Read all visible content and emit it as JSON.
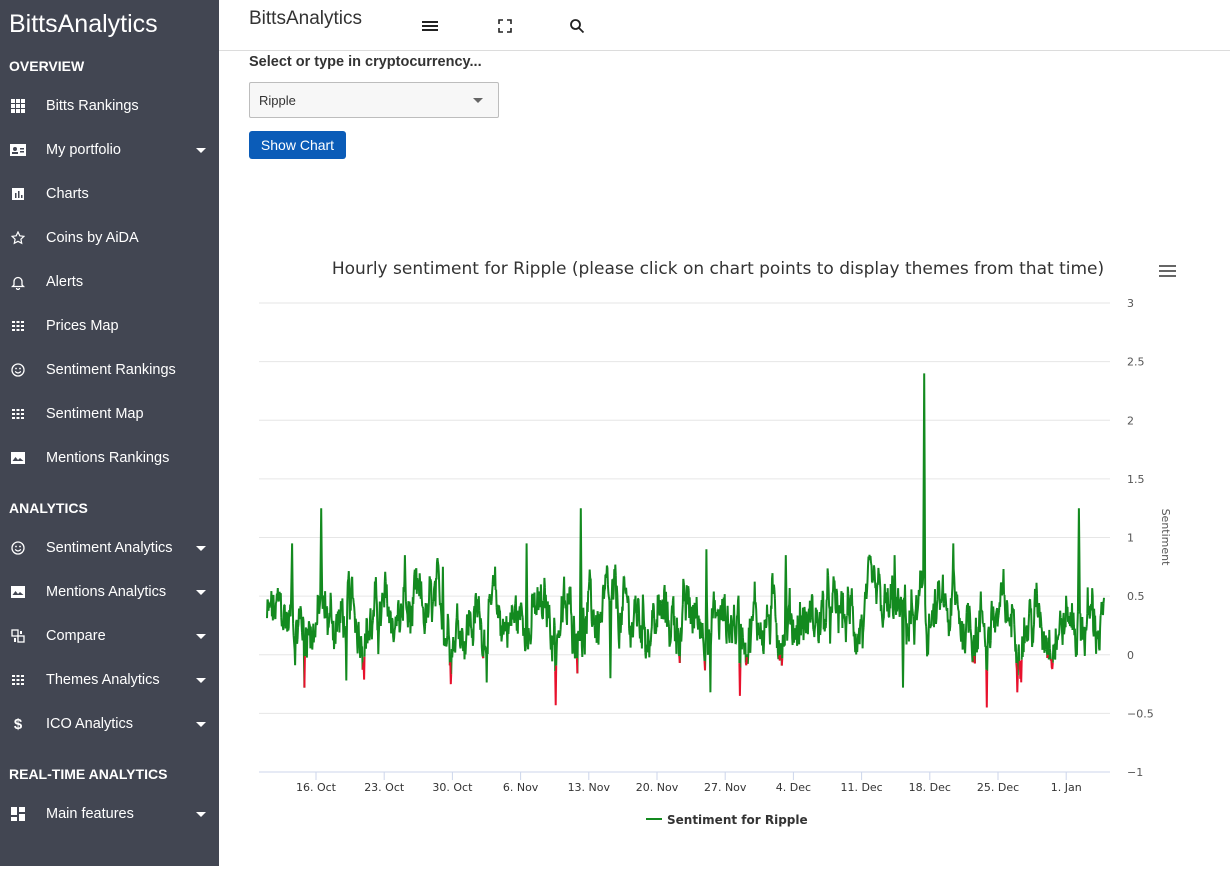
{
  "sidebar": {
    "brand": "BittsAnalytics",
    "sections": {
      "overview": "OVERVIEW",
      "analytics": "ANALYTICS",
      "realtime": "REAL-TIME ANALYTICS"
    },
    "items": [
      {
        "label": "Bitts Rankings",
        "icon": "grid-icon",
        "caret": false
      },
      {
        "label": "My portfolio",
        "icon": "id-card-icon",
        "caret": true
      },
      {
        "label": "Charts",
        "icon": "bar-chart-icon",
        "caret": false
      },
      {
        "label": "Coins by AiDA",
        "icon": "star-icon",
        "caret": false
      },
      {
        "label": "Alerts",
        "icon": "bell-icon",
        "caret": false
      },
      {
        "label": "Prices Map",
        "icon": "dots-grid-icon",
        "caret": false
      },
      {
        "label": "Sentiment Rankings",
        "icon": "smiley-icon",
        "caret": false
      },
      {
        "label": "Sentiment Map",
        "icon": "dots-grid-icon",
        "caret": false
      },
      {
        "label": "Mentions Rankings",
        "icon": "image-chart-icon",
        "caret": false
      },
      {
        "label": "Sentiment Analytics",
        "icon": "smiley-icon",
        "caret": true
      },
      {
        "label": "Mentions Analytics",
        "icon": "image-chart-icon",
        "caret": true
      },
      {
        "label": "Compare",
        "icon": "compare-icon",
        "caret": true
      },
      {
        "label": "Themes Analytics",
        "icon": "dots-grid-icon",
        "caret": true
      },
      {
        "label": "ICO Analytics",
        "icon": "dollar-icon",
        "caret": true
      },
      {
        "label": "Main features",
        "icon": "dashboard-icon",
        "caret": true
      }
    ]
  },
  "topbar": {
    "title": "BittsAnalytics",
    "icons": [
      "menu-icon",
      "fullscreen-icon",
      "search-icon"
    ]
  },
  "form": {
    "label": "Select or type in cryptocurrency...",
    "selected": "Ripple",
    "button": "Show Chart"
  },
  "colors": {
    "sidebar_bg": "#424652",
    "positive": "#138a1f",
    "negative": "#e8112d",
    "button": "#0b5cb8"
  },
  "chart_data": {
    "type": "line",
    "title": "Hourly sentiment for Ripple (please click on chart points to display themes from that time)",
    "ylabel": "Sentiment",
    "xlabel": "",
    "ylim": [
      -1,
      3
    ],
    "yticks": [
      "3",
      "2.5",
      "2",
      "1.5",
      "1",
      "0.5",
      "0",
      "−0.5",
      "−1"
    ],
    "ytick_values": [
      3,
      2.5,
      2,
      1.5,
      1,
      0.5,
      0,
      -0.5,
      -1
    ],
    "xticks": [
      "16. Oct",
      "23. Oct",
      "30. Oct",
      "6. Nov",
      "13. Nov",
      "20. Nov",
      "27. Nov",
      "4. Dec",
      "11. Dec",
      "18. Dec",
      "25. Dec",
      "1. Jan"
    ],
    "x_start": "10. Oct",
    "x_end": "5. Jan",
    "legend": "Sentiment for Ripple",
    "legend_position": "bottom-center",
    "grid": true,
    "baseline": 0.3,
    "noise": 0.14,
    "series": [
      {
        "name": "Sentiment for Ripple",
        "color_above_zero": "#138a1f",
        "color_below_zero": "#e8112d",
        "spikes": [
          {
            "x": 0.03,
            "y": 0.95
          },
          {
            "x": 0.065,
            "y": 1.25
          },
          {
            "x": 0.045,
            "y": -0.28
          },
          {
            "x": 0.095,
            "y": -0.22
          },
          {
            "x": 0.165,
            "y": 0.85
          },
          {
            "x": 0.21,
            "y": 0.75
          },
          {
            "x": 0.31,
            "y": 0.95
          },
          {
            "x": 0.345,
            "y": -0.43
          },
          {
            "x": 0.375,
            "y": 1.25
          },
          {
            "x": 0.41,
            "y": -0.2
          },
          {
            "x": 0.525,
            "y": 0.9
          },
          {
            "x": 0.53,
            "y": -0.32
          },
          {
            "x": 0.565,
            "y": -0.35
          },
          {
            "x": 0.62,
            "y": 0.85
          },
          {
            "x": 0.75,
            "y": 0.85
          },
          {
            "x": 0.76,
            "y": -0.28
          },
          {
            "x": 0.785,
            "y": 2.4
          },
          {
            "x": 0.82,
            "y": 0.95
          },
          {
            "x": 0.86,
            "y": -0.45
          },
          {
            "x": 0.97,
            "y": 1.25
          }
        ]
      }
    ]
  }
}
